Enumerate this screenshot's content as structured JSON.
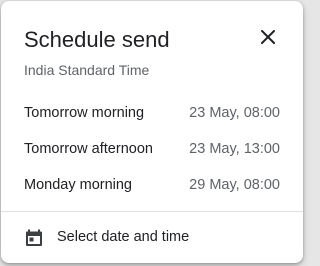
{
  "dialog": {
    "title": "Schedule send",
    "timezone": "India Standard Time",
    "close_icon": "close-icon"
  },
  "options": [
    {
      "label": "Tomorrow morning",
      "time": "23 May, 08:00"
    },
    {
      "label": "Tomorrow afternoon",
      "time": "23 May, 13:00"
    },
    {
      "label": "Monday morning",
      "time": "29 May, 08:00"
    }
  ],
  "custom": {
    "label": "Select date and time",
    "icon": "calendar-icon"
  },
  "colors": {
    "text_primary": "#202124",
    "text_secondary": "#5f6368",
    "divider": "#e0e0e0"
  }
}
